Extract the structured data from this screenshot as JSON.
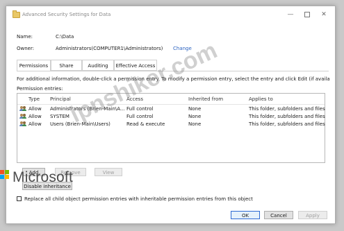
{
  "window": {
    "title": "Advanced Security Settings for Data",
    "minimize": "—",
    "close": "✕"
  },
  "info": {
    "name_label": "Name:",
    "name_value": "C:\\Data",
    "owner_label": "Owner:",
    "owner_value": "Administrators(COMPUTER1\\Administrators)",
    "change_link": "Change"
  },
  "tabs": [
    "Permissions",
    "Share",
    "Auditing",
    "Effective Access"
  ],
  "permissions": {
    "description": "For additional information, double-click a permission entry. To modify a permission entry, select the entry and click Edit (if available).",
    "entries_label": "Permission entries:",
    "columns": [
      "Type",
      "Principal",
      "Access",
      "Inherited from",
      "Applies to"
    ],
    "rows": [
      {
        "type": "Allow",
        "principal": "Administrators (Brien-Main\\A...",
        "access": "Full control",
        "inherited": "None",
        "applies": "This folder, subfolders and files"
      },
      {
        "type": "Allow",
        "principal": "SYSTEM",
        "access": "Full control",
        "inherited": "None",
        "applies": "This folder, subfolders and files"
      },
      {
        "type": "Allow",
        "principal": "Users (Brien-Main\\Users)",
        "access": "Read & execute",
        "inherited": "None",
        "applies": "This folder, subfolders and files"
      }
    ]
  },
  "buttons": {
    "add": "Add",
    "remove": "Remove",
    "view": "View",
    "disable_inheritance": "Disable inheritance",
    "ok": "OK",
    "cancel": "Cancel",
    "apply": "Apply"
  },
  "replace_checkbox_label": "Replace all child object permission entries with inheritable permission entries from this object",
  "overlay": {
    "brand": "Microsoft",
    "watermark": "ipnshiker.com"
  },
  "colors": {
    "link": "#2b62c0",
    "ms_red": "#f25022",
    "ms_green": "#7fba00",
    "ms_blue": "#00a4ef",
    "ms_yellow": "#ffb900"
  }
}
